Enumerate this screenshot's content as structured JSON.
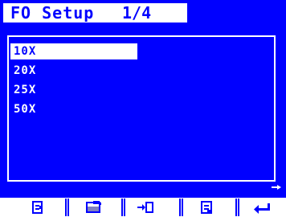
{
  "header": {
    "title": "FO Setup",
    "page_indicator": "1/4"
  },
  "list": {
    "items": [
      {
        "label": "10X",
        "selected": true
      },
      {
        "label": "20X",
        "selected": false
      },
      {
        "label": "25X",
        "selected": false
      },
      {
        "label": "50X",
        "selected": false
      }
    ]
  },
  "softkeys": [
    {
      "icon": "document-icon"
    },
    {
      "icon": "folder-icon"
    },
    {
      "icon": "import-icon"
    },
    {
      "icon": "page-icon"
    },
    {
      "icon": "enter-icon"
    }
  ],
  "colors": {
    "background": "#0000ff",
    "foreground": "#ffffff"
  }
}
